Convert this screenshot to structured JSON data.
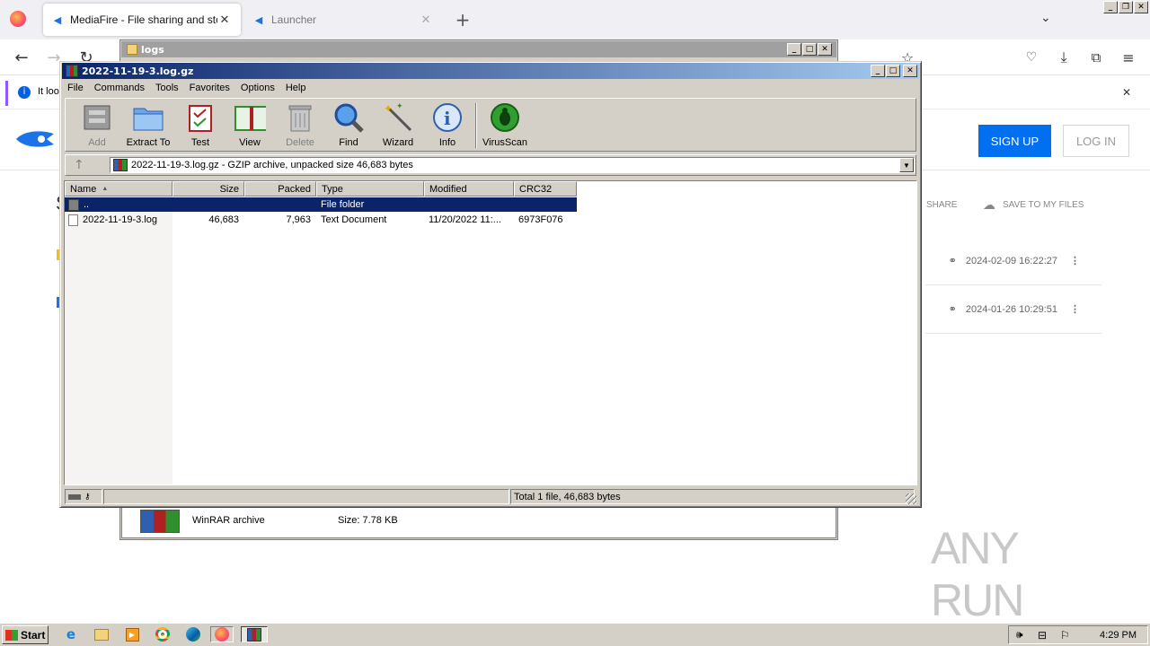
{
  "browser": {
    "tabs": [
      {
        "title": "MediaFire - File sharing and storag",
        "active": true
      },
      {
        "title": "Launcher",
        "active": false
      }
    ],
    "new_tab": "+",
    "notification_text": "It loo"
  },
  "mediafire": {
    "signup": "SIGN UP",
    "login": "LOG IN",
    "share": "SHARE",
    "save": "SAVE TO MY FILES",
    "rows": [
      {
        "date": "2024-02-09 16:22:27"
      },
      {
        "date": "2024-01-26 10:29:51"
      }
    ]
  },
  "logs_window": {
    "title": "logs",
    "file_type": "WinRAR archive",
    "size": "Size: 7.78 KB"
  },
  "rar": {
    "title": "2022-11-19-3.log.gz",
    "menu": [
      "File",
      "Commands",
      "Tools",
      "Favorites",
      "Options",
      "Help"
    ],
    "toolbar": [
      {
        "label": "Add",
        "icon": "add-icon",
        "disabled": true
      },
      {
        "label": "Extract To",
        "icon": "folder-icon",
        "disabled": false
      },
      {
        "label": "Test",
        "icon": "test-icon",
        "disabled": false
      },
      {
        "label": "View",
        "icon": "book-icon",
        "disabled": false
      },
      {
        "label": "Delete",
        "icon": "trash-icon",
        "disabled": true
      },
      {
        "label": "Find",
        "icon": "magnifier-icon",
        "disabled": false
      },
      {
        "label": "Wizard",
        "icon": "wand-icon",
        "disabled": false
      },
      {
        "label": "Info",
        "icon": "info-icon",
        "disabled": false
      },
      {
        "label": "VirusScan",
        "icon": "bug-icon",
        "disabled": false
      }
    ],
    "path": "2022-11-19-3.log.gz - GZIP archive, unpacked size 46,683 bytes",
    "columns": [
      "Name",
      "Size",
      "Packed",
      "Type",
      "Modified",
      "CRC32"
    ],
    "rows": [
      {
        "name": "..",
        "size": "",
        "packed": "",
        "type": "File folder",
        "modified": "",
        "crc": "",
        "selected": true
      },
      {
        "name": "2022-11-19-3.log",
        "size": "46,683",
        "packed": "7,963",
        "type": "Text Document",
        "modified": "11/20/2022 11:...",
        "crc": "6973F076",
        "selected": false
      }
    ],
    "status": "Total 1 file, 46,683 bytes"
  },
  "taskbar": {
    "start": "Start",
    "clock": "4:29 PM"
  },
  "watermark": "ANY RUN",
  "colors": {
    "title_active": "#0a246a",
    "selection": "#0a246a",
    "mediafire_blue": "#0070f0"
  }
}
